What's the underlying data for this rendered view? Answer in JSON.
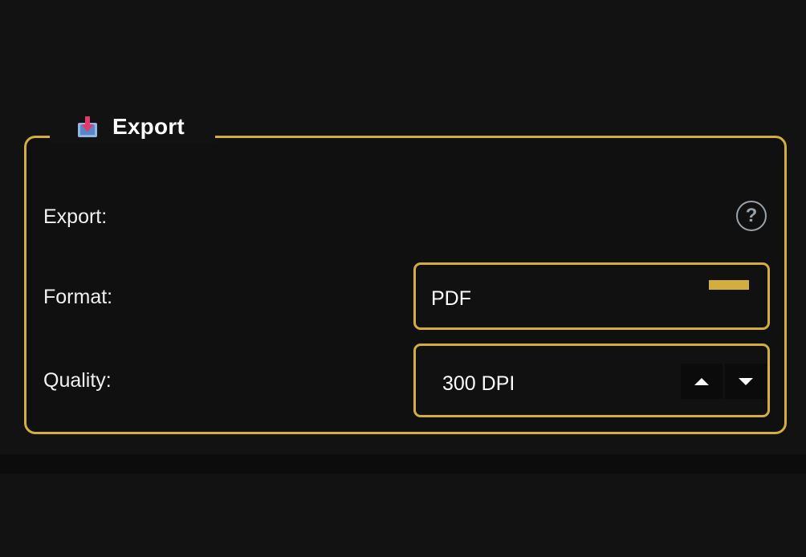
{
  "group": {
    "title": "Export",
    "icon": "export-icon"
  },
  "rows": {
    "export_label": "Export:",
    "format_label": "Format:",
    "quality_label": "Quality:"
  },
  "help": {
    "symbol": "?",
    "icon": "help-icon"
  },
  "format": {
    "value": "PDF"
  },
  "quality": {
    "value": "300 DPI"
  },
  "colors": {
    "accent": "#d2ae3f",
    "background": "#121212",
    "text": "#f2f2f2"
  }
}
